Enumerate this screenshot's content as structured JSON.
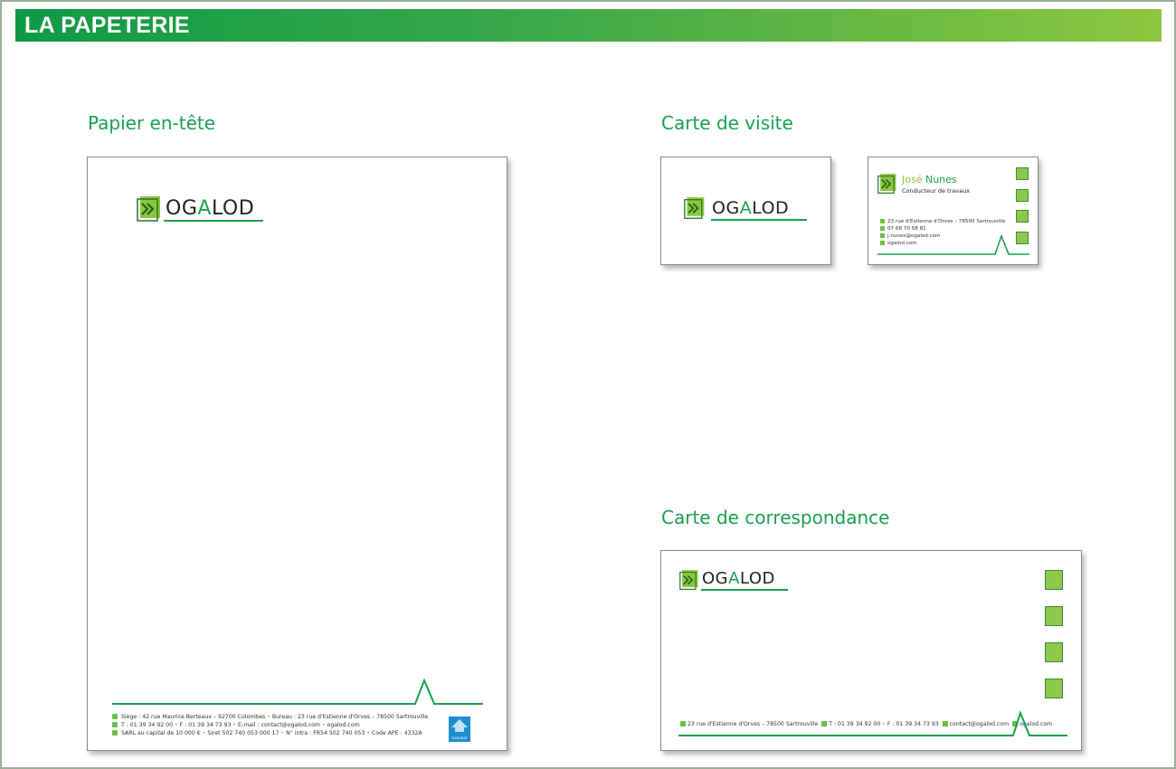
{
  "header": {
    "title": "LA PAPETERIE"
  },
  "colors": {
    "brand_green": "#1aa050",
    "light_green": "#8dc63f",
    "frame": "#9aae9a"
  },
  "brand": {
    "logo_prefix": "OG",
    "logo_accent": "A",
    "logo_suffix": "LOD"
  },
  "letterhead": {
    "section_title": "Papier en-tête",
    "footer": {
      "line1": "Siège : 42 rue Maurice Berteaux – 92700 Colombes",
      "line1b": "Bureau : 23 rue d'Estienne d'Orves – 78500 Sartrouville",
      "line2a": "T : 01 39 34 92 00",
      "line2b": "F : 01 39 34 73 93",
      "line2c": "E-mail : contact@ogalod.com",
      "line2d": "ogalod.com",
      "line3a": "SARL au capital de 10 000 €",
      "line3b": "Siret 502 740 053 000 17",
      "line3c": "N° intra : FR54 502 740 053",
      "line3d": "Code APE : 4332A"
    },
    "badge_label": "QUALIBAT"
  },
  "business_card": {
    "section_title": "Carte de visite",
    "first_name": "José",
    "last_name": "Nunes",
    "job_title": "Conducteur de travaux",
    "address": "23 rue d'Estienne d'Orves – 78500 Sartrouville",
    "phone": "07 68 70 58 81",
    "email": "j.nunes@ogalod.com",
    "website": "ogalod.com"
  },
  "correspondence_card": {
    "section_title": "Carte de correspondance",
    "footer_address": "23 rue d'Estienne d'Orves – 78500 Sartrouville",
    "footer_phone": "T : 01 39 34 92 00",
    "footer_fax": "F : 01 39 34 73 93",
    "footer_email": "contact@ogalod.com",
    "footer_web": "ogalod.com"
  }
}
